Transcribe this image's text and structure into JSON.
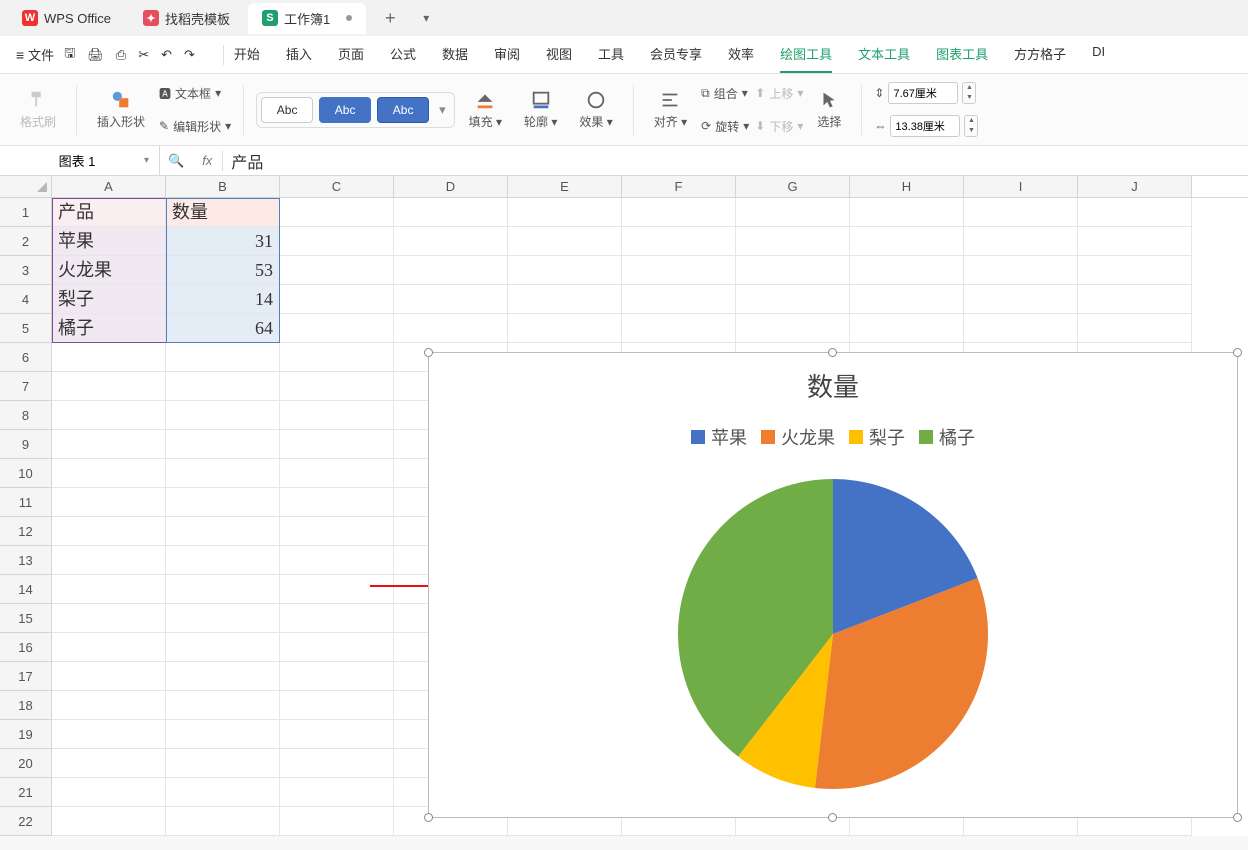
{
  "title_tabs": [
    {
      "icon": "W",
      "label": "WPS Office"
    },
    {
      "icon": "D",
      "label": "找稻壳模板"
    },
    {
      "icon": "S",
      "label": "工作簿1",
      "active": true
    }
  ],
  "menubar": {
    "file": "文件",
    "tabs": [
      "开始",
      "插入",
      "页面",
      "公式",
      "数据",
      "审阅",
      "视图",
      "工具",
      "会员专享",
      "效率",
      "绘图工具",
      "文本工具",
      "图表工具",
      "方方格子",
      "DI"
    ],
    "active_tab_idx": 10
  },
  "ribbon": {
    "brush": "格式刷",
    "insert_shape": "插入形状",
    "textbox": "文本框",
    "edit_shape": "编辑形状",
    "style_label": "Abc",
    "fill": "填充",
    "outline": "轮廓",
    "effect": "效果",
    "align": "对齐",
    "group": "组合",
    "rotate": "旋转",
    "up": "上移",
    "down": "下移",
    "select": "选择",
    "width_val": "7.67厘米",
    "height_val": "13.38厘米"
  },
  "fbar": {
    "name": "图表 1",
    "fx": "fx",
    "value": "产品"
  },
  "columns": [
    "A",
    "B",
    "C",
    "D",
    "E",
    "F",
    "G",
    "H",
    "I",
    "J"
  ],
  "table": {
    "headerA": "产品",
    "headerB": "数量",
    "rows": [
      {
        "p": "苹果",
        "q": "31"
      },
      {
        "p": "火龙果",
        "q": "53"
      },
      {
        "p": "梨子",
        "q": "14"
      },
      {
        "p": "橘子",
        "q": "64"
      }
    ]
  },
  "chart_data": {
    "type": "pie",
    "title": "数量",
    "categories": [
      "苹果",
      "火龙果",
      "梨子",
      "橘子"
    ],
    "values": [
      31,
      53,
      14,
      64
    ],
    "colors": [
      "#4472c4",
      "#ed7d31",
      "#ffc000",
      "#70ad47"
    ]
  },
  "row_count": 22
}
